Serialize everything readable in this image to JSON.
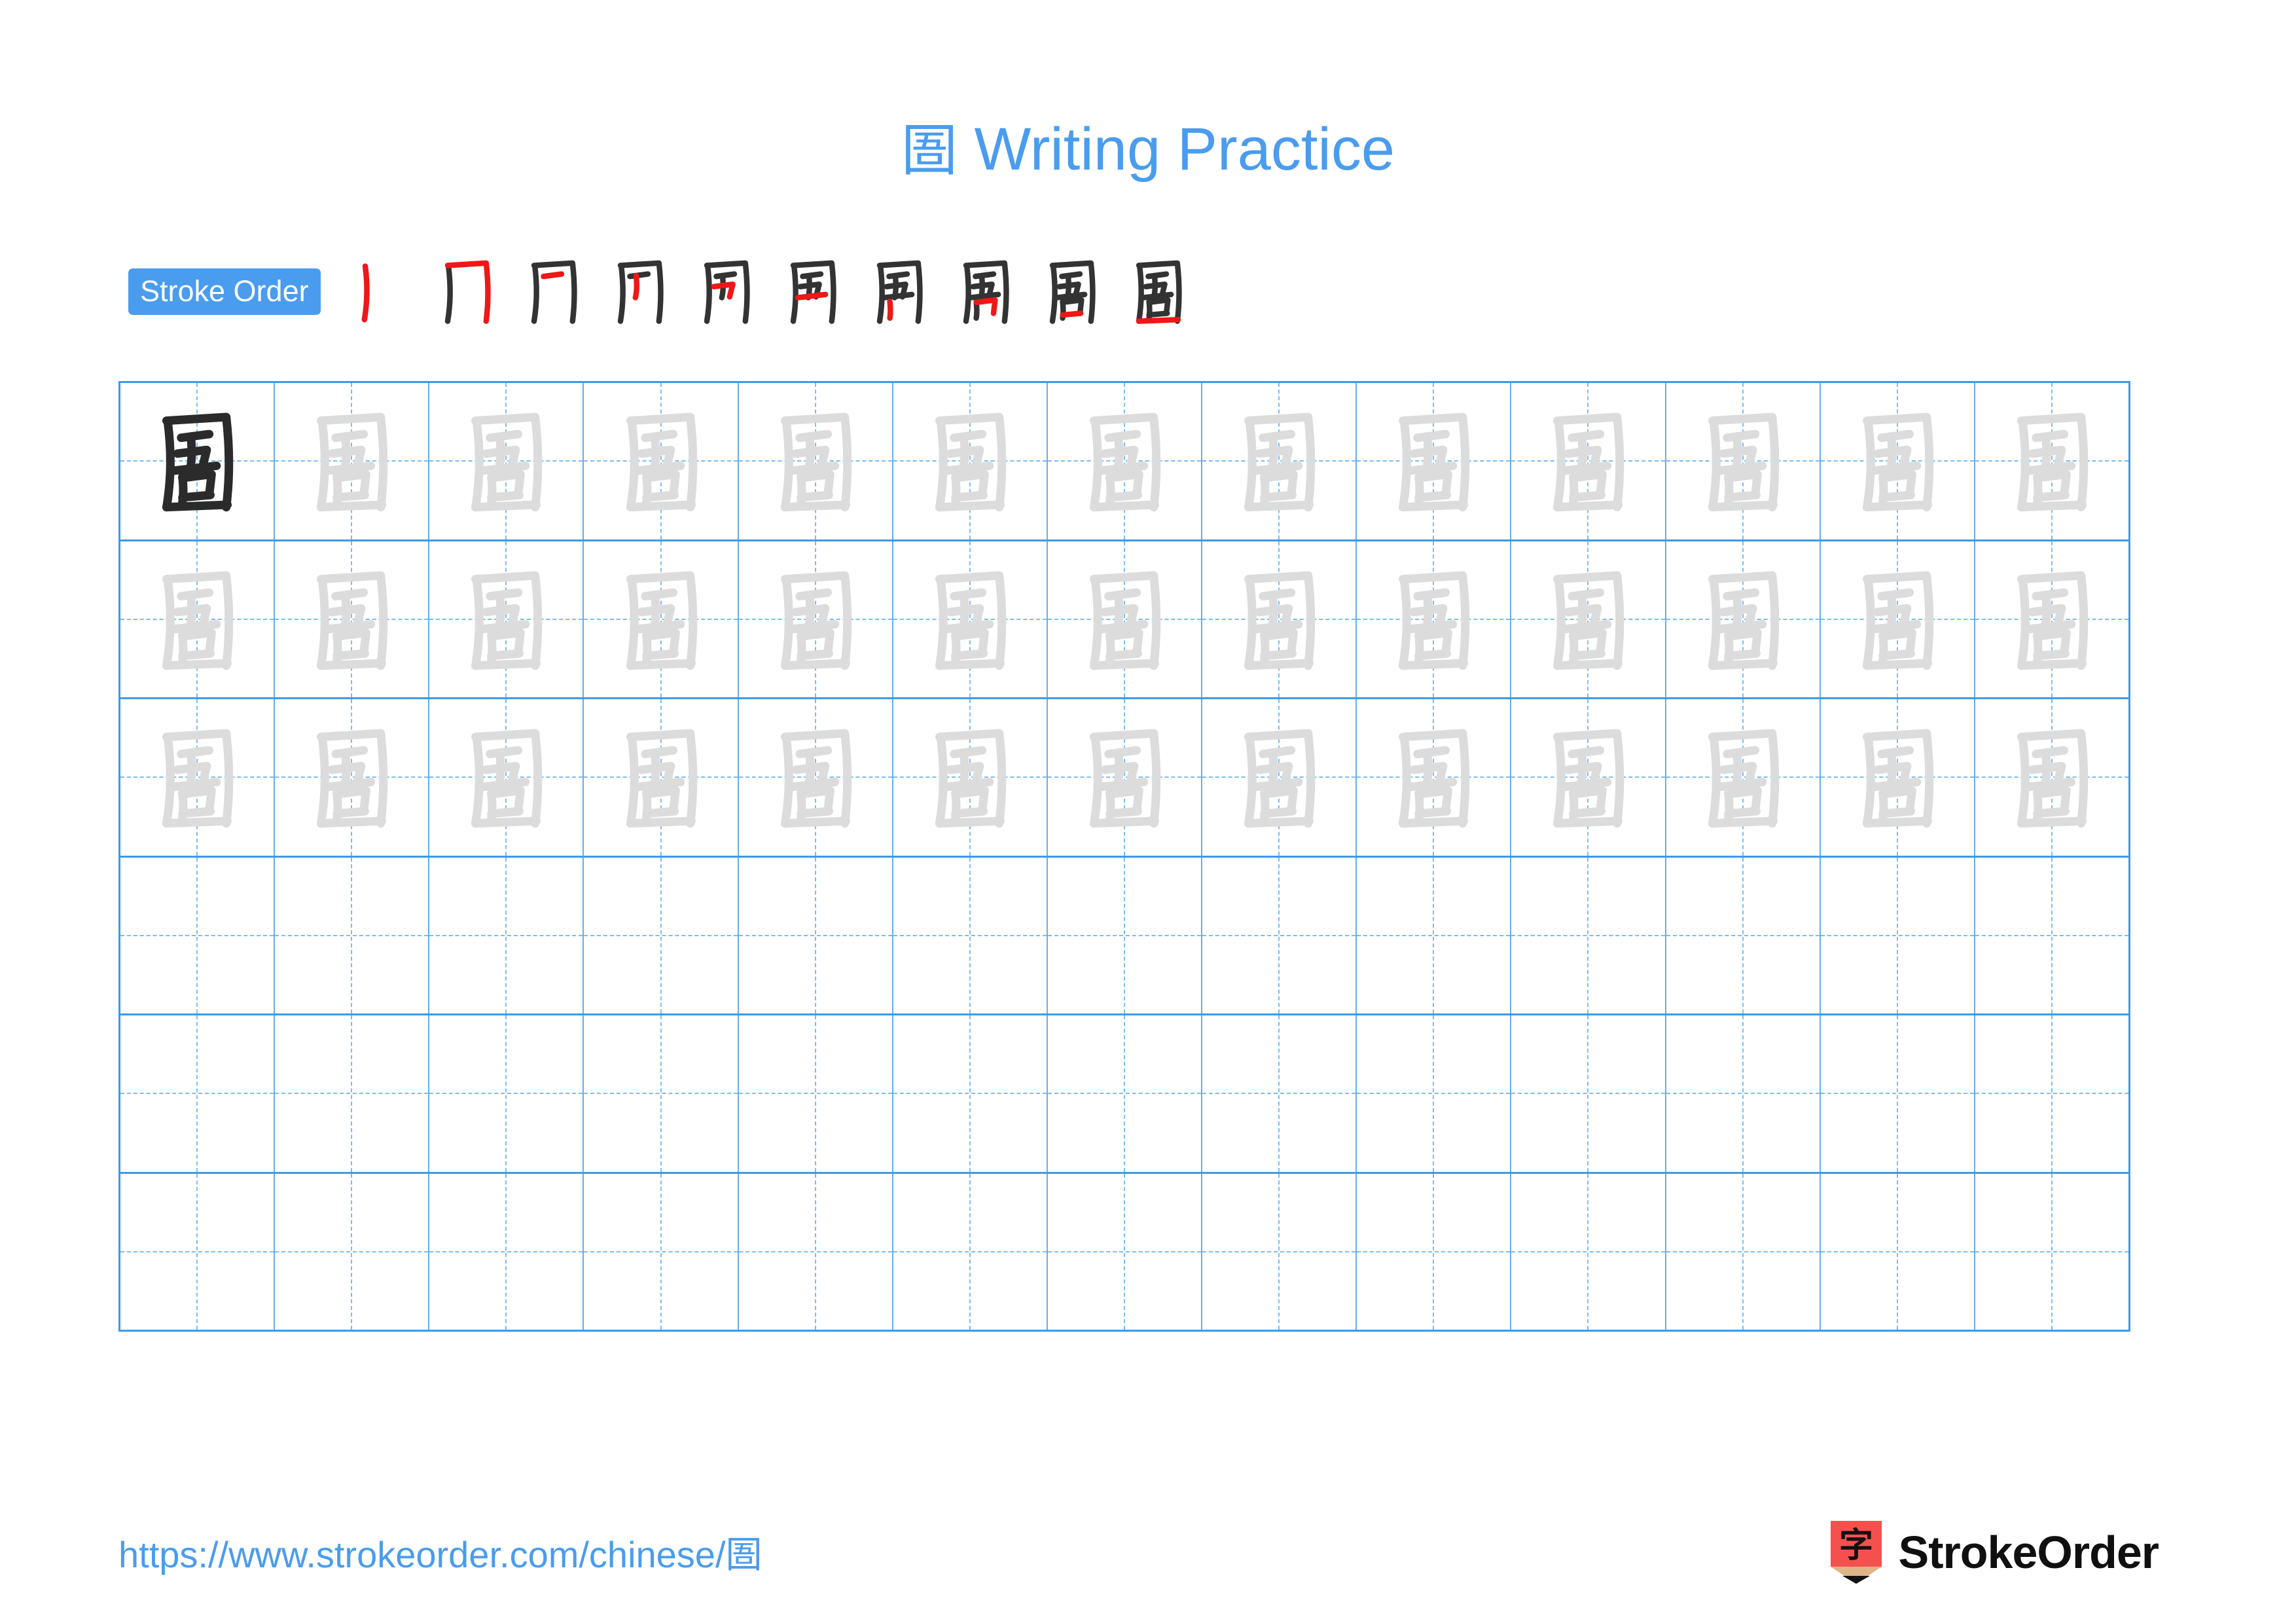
{
  "header": {
    "character": "圄",
    "title": "Writing Practice"
  },
  "stroke_order": {
    "label": "Stroke Order",
    "total_strokes": 10,
    "steps": [
      {
        "index": 1,
        "new_stroke": "丨 vertical left side of enclosure"
      },
      {
        "index": 2,
        "new_stroke": "𠃍 horizontal-turn-vertical top and right side"
      },
      {
        "index": 3,
        "new_stroke": "一 short horizontal, top of 吾"
      },
      {
        "index": 4,
        "new_stroke": "丨 vertical of 五 component"
      },
      {
        "index": 5,
        "new_stroke": "𠃍 horizontal-turn of 五"
      },
      {
        "index": 6,
        "new_stroke": "一 horizontal closing 五"
      },
      {
        "index": 7,
        "new_stroke": "丨 vertical of 口 component"
      },
      {
        "index": 8,
        "new_stroke": "𠃍 horizontal-turn of 口"
      },
      {
        "index": 9,
        "new_stroke": "一 horizontal closing 口"
      },
      {
        "index": 10,
        "new_stroke": "一 bottom horizontal closing enclosure"
      }
    ],
    "new_stroke_color": "#ef1717",
    "existing_stroke_color": "#333333"
  },
  "practice_grid": {
    "columns": 13,
    "rows": 6,
    "cells": [
      [
        "model",
        "trace",
        "trace",
        "trace",
        "trace",
        "trace",
        "trace",
        "trace",
        "trace",
        "trace",
        "trace",
        "trace",
        "trace"
      ],
      [
        "trace",
        "trace",
        "trace",
        "trace",
        "trace",
        "trace",
        "trace",
        "trace",
        "trace",
        "trace",
        "trace",
        "trace",
        "trace"
      ],
      [
        "trace",
        "trace",
        "trace",
        "trace",
        "trace",
        "trace",
        "trace",
        "trace",
        "trace",
        "trace",
        "trace",
        "trace",
        "trace"
      ],
      [
        "empty",
        "empty",
        "empty",
        "empty",
        "empty",
        "empty",
        "empty",
        "empty",
        "empty",
        "empty",
        "empty",
        "empty",
        "empty"
      ],
      [
        "empty",
        "empty",
        "empty",
        "empty",
        "empty",
        "empty",
        "empty",
        "empty",
        "empty",
        "empty",
        "empty",
        "empty",
        "empty"
      ],
      [
        "empty",
        "empty",
        "empty",
        "empty",
        "empty",
        "empty",
        "empty",
        "empty",
        "empty",
        "empty",
        "empty",
        "empty",
        "empty"
      ]
    ],
    "character": "圄",
    "model_color": "#2b2b2b",
    "trace_color": "#dcdcdc",
    "grid_line_color": "#3d9ae8",
    "guide_line_color": "#7dbbf2"
  },
  "footer": {
    "url": "https://www.strokeorder.com/chinese/",
    "url_character": "圄",
    "brand": "StrokeOrder",
    "brand_accent_color": "#f4514e",
    "link_color": "#4a9cee"
  },
  "theme": {
    "accent": "#4a9cee",
    "background": "#ffffff"
  }
}
